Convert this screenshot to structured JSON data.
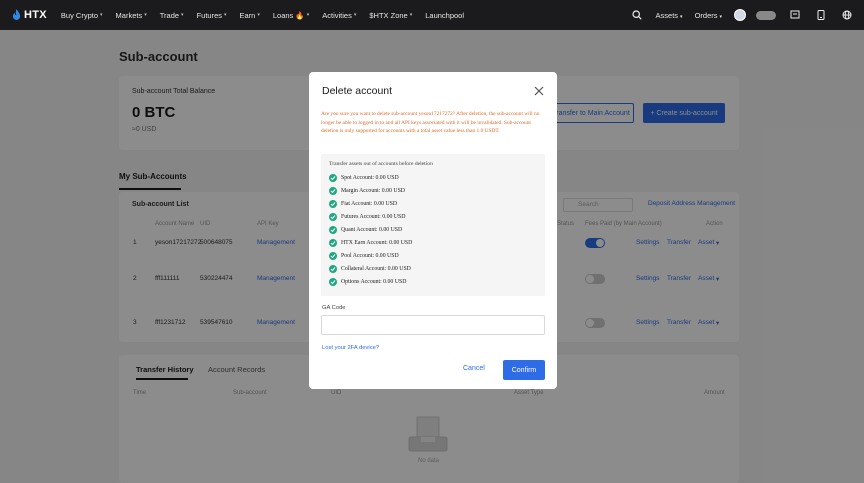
{
  "nav": {
    "logo": "HTX",
    "items": [
      {
        "label": "Buy Crypto",
        "caret": true
      },
      {
        "label": "Markets",
        "caret": true
      },
      {
        "label": "Trade",
        "caret": true
      },
      {
        "label": "Futures",
        "caret": true
      },
      {
        "label": "Earn",
        "caret": true
      },
      {
        "label": "Loans 🔥",
        "caret": true
      },
      {
        "label": "Activities",
        "caret": true
      },
      {
        "label": "$HTX Zone",
        "caret": true
      },
      {
        "label": "Launchpool",
        "caret": false
      }
    ],
    "assets": "Assets",
    "orders": "Orders"
  },
  "page": {
    "title": "Sub-account",
    "total_label": "Sub-account Total Balance",
    "total_btc": "0 BTC",
    "total_usd": "≈0 USD",
    "transfer_main": "Transfer to Main Account",
    "create": "+ Create sub-account",
    "tab_my": "My Sub-Accounts",
    "list_title": "Sub-account List",
    "search_placeholder": "Search",
    "deposit_link": "Deposit Address Management",
    "headers": {
      "name": "Account Name",
      "uid": "UID",
      "apikey": "API Key",
      "status": "Status",
      "fees": "Fees Paid (by Main Account)",
      "action": "Action"
    },
    "rows": [
      {
        "idx": "1",
        "name": "yeson17217272",
        "uid": "500648075",
        "mgmt": "Management",
        "toggle": "on"
      },
      {
        "idx": "2",
        "name": "fff111111",
        "uid": "530224474",
        "mgmt": "Management",
        "toggle": "off"
      },
      {
        "idx": "3",
        "name": "fff1231712",
        "uid": "539547610",
        "mgmt": "Management",
        "toggle": "off"
      }
    ],
    "actions": {
      "settings": "Settings",
      "transfer": "Transfer",
      "asset": "Asset"
    },
    "history_tabs": [
      "Transfer History",
      "Account Records"
    ],
    "history_headers": {
      "time": "Time",
      "subaccount": "Sub-account",
      "uid": "UID",
      "asset_type": "Asset Type",
      "amount": "Amount"
    },
    "no_data": "No data"
  },
  "modal": {
    "title": "Delete account",
    "warning": "Are you sure you want to delete sub-account yeson17217272? After deletion, the sub-account will no longer be able to logged in to and all API keys associated with it will be invalidated. Sub-account deletion is only supported for accounts with a total asset value less than 1.0 USDT.",
    "assets_title": "Transfer assets out of accounts before deletion",
    "assets": [
      "Spot Account: 0.00 USD",
      "Margin Account: 0.00 USD",
      "Fiat Account: 0.00 USD",
      "Futures Account: 0.00 USD",
      "Quant Account: 0.00 USD",
      "HTX Earn Account: 0.00 USD",
      "Pool Account: 0.00 USD",
      "Collateral Account: 0.00 USD",
      "Options Account: 0.00 USD"
    ],
    "ga_label": "GA Code",
    "lost_link": "Lost your 2FA device?",
    "cancel": "Cancel",
    "confirm": "Confirm"
  },
  "colors": {
    "accent": "#2e6be6",
    "warning": "#e06b28",
    "success": "#1fa882",
    "nav_bg": "#1b1b1d"
  }
}
